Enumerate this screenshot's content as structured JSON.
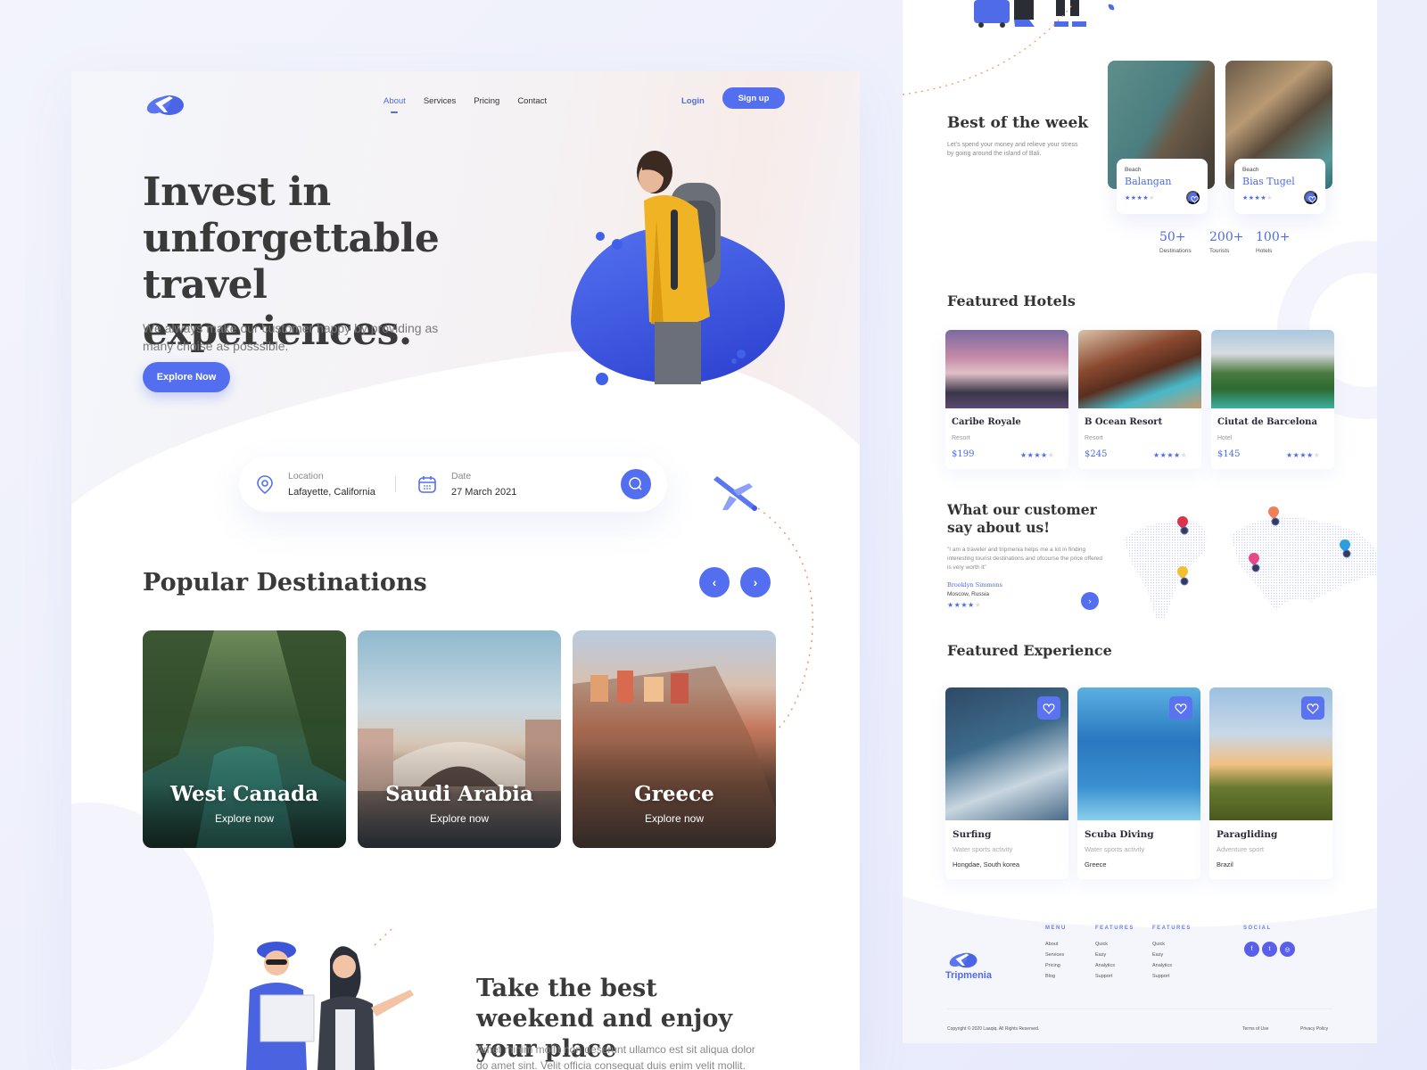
{
  "colors": {
    "accent": "#536ff0",
    "accent_text": "#4e6be8",
    "heading": "#3a3a3a",
    "muted": "#8a8a8a",
    "orange_path": "#f0945a"
  },
  "landing": {
    "nav": {
      "links": [
        {
          "label": "About",
          "active": true
        },
        {
          "label": "Services",
          "active": false
        },
        {
          "label": "Pricing",
          "active": false
        },
        {
          "label": "Contact",
          "active": false
        }
      ],
      "login": "Login",
      "signup": "Sign up"
    },
    "hero": {
      "title": "Invest in unforgettable travel experiences.",
      "subtitle": "We always make our customer happy by providing as many choise as posssible.",
      "cta": "Explore Now"
    },
    "search": {
      "location_label": "Location",
      "location_value": "Lafayette, California",
      "date_label": "Date",
      "date_value": "27 March 2021"
    },
    "popular": {
      "title": "Popular Destinations",
      "prev": "‹",
      "next": "›",
      "destinations": [
        {
          "name": "West Canada",
          "link": "Explore now"
        },
        {
          "name": "Saudi Arabia",
          "link": "Explore now"
        },
        {
          "name": "Greece",
          "link": "Explore now"
        }
      ]
    },
    "weekend": {
      "title": "Take the best weekend and enjoy your place",
      "text": "Amet minim mollit non deserunt ullamco est sit aliqua dolor do amet sint. Velit officia consequat duis enim velit mollit."
    }
  },
  "detail": {
    "best_week": {
      "title": "Best of the week",
      "text": "Let's spend your money and relieve your stress by going around the island of Bali.",
      "places": [
        {
          "category": "Beach",
          "name": "Balangan",
          "rating": 4,
          "max": 5
        },
        {
          "category": "Beach",
          "name": "Bias Tugel",
          "rating": 4,
          "max": 5
        }
      ],
      "stats": [
        {
          "value": "50+",
          "label": "Destinations"
        },
        {
          "value": "200+",
          "label": "Tourists"
        },
        {
          "value": "100+",
          "label": "Hotels"
        }
      ]
    },
    "hotels": {
      "title": "Featured Hotels",
      "items": [
        {
          "name": "Caribe Royale",
          "type": "Resort",
          "price": "$199",
          "rating": 4
        },
        {
          "name": "B Ocean Resort",
          "type": "Resort",
          "price": "$245",
          "rating": 4
        },
        {
          "name": "Ciutat de Barcelona",
          "type": "Hotel",
          "price": "$145",
          "rating": 4
        }
      ]
    },
    "testimonial": {
      "title": "What our customer say about us!",
      "quote": "\"I am a traveler and tripmenia helps me a lot in finding interesting tourist destinations and ofcourse the price offered is very worth it\"",
      "name": "Brooklyn Simmons",
      "location": "Moscow, Russia",
      "rating": 4,
      "next": "›"
    },
    "experience": {
      "title": "Featured Experience",
      "items": [
        {
          "name": "Surfing",
          "type": "Water sports activity",
          "location": "Hongdae, South korea"
        },
        {
          "name": "Scuba Diving",
          "type": "Water sports activity",
          "location": "Greece"
        },
        {
          "name": "Paragliding",
          "type": "Adventure sport",
          "location": "Brazil"
        }
      ]
    },
    "footer": {
      "brand": "Tripmenia",
      "columns": [
        {
          "heading": "MENU",
          "items": [
            "About",
            "Services",
            "Pricing",
            "Blog"
          ]
        },
        {
          "heading": "FEATURES",
          "items": [
            "Quick",
            "Easy",
            "Analytics",
            "Support"
          ]
        },
        {
          "heading": "FEATURES",
          "items": [
            "Quick",
            "Easy",
            "Analytics",
            "Support"
          ]
        }
      ],
      "social_heading": "SOCIAL",
      "social": [
        {
          "icon": "facebook-icon",
          "glyph": "f"
        },
        {
          "icon": "twitter-icon",
          "glyph": "t"
        },
        {
          "icon": "instagram-icon",
          "glyph": "◎"
        }
      ],
      "copyright": "Copyright © 2020 Laaqiq. All Rights Reserved.",
      "terms": "Terms of Use",
      "privacy": "Privacy Policy"
    }
  }
}
